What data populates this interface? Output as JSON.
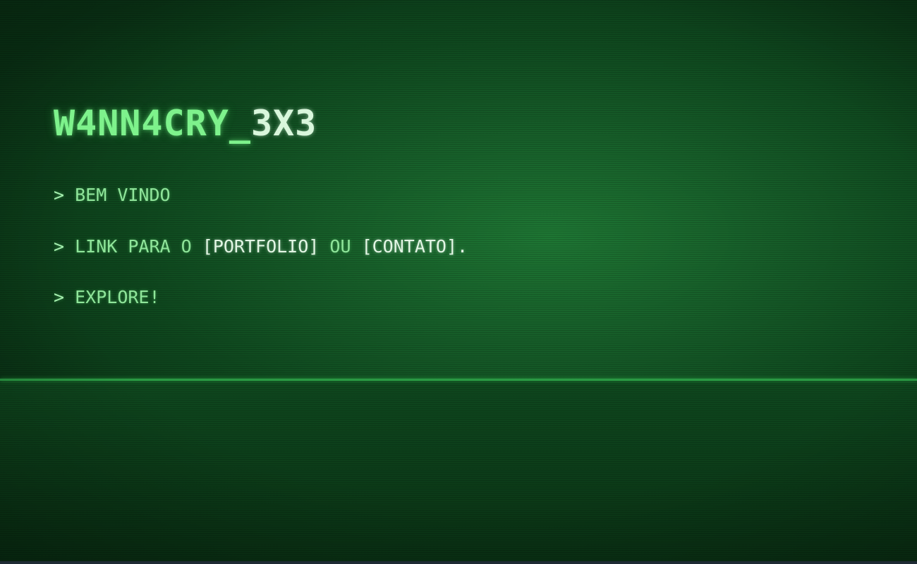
{
  "header": {
    "title_main": "W4NN4CRY_",
    "title_alt": "3X3"
  },
  "terminal": {
    "prompt": ">",
    "welcome": "BEM VINDO",
    "link_prefix": "LINK PARA O",
    "portfolio_label": "[PORTFOLIO]",
    "or_text": "OU",
    "contact_label": "[CONTATO]",
    "period": ".",
    "explore": "EXPLORE!"
  },
  "colors": {
    "accent": "#7ef28c",
    "link": "#e2f6e4",
    "horizon": "#2ea84a"
  }
}
